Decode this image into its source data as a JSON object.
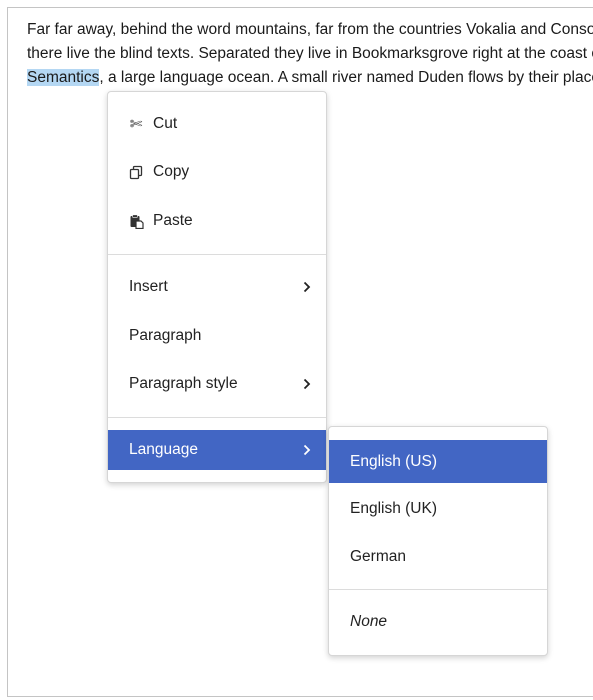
{
  "document": {
    "line1": "Far far away, behind the word mountains, far from the countries Vokalia and Consonantia,",
    "line2": "there live the blind texts. Separated they live in Bookmarksgrove right at the coast of the",
    "line3_selected": "Semantics",
    "line3_rest": ", a large language ocean. A small river named Duden flows by their place."
  },
  "context_menu": {
    "items": [
      {
        "label": "Cut",
        "icon": "scissors-icon"
      },
      {
        "label": "Copy",
        "icon": "copy-icon"
      },
      {
        "label": "Paste",
        "icon": "paste-icon"
      },
      {
        "label": "Insert",
        "submenu": true
      },
      {
        "label": "Paragraph"
      },
      {
        "label": "Paragraph style",
        "submenu": true
      },
      {
        "label": "Language",
        "submenu": true,
        "active": true
      }
    ]
  },
  "language_submenu": {
    "items": [
      {
        "label": "English (US)",
        "active": true
      },
      {
        "label": "English (UK)"
      },
      {
        "label": "German"
      },
      {
        "label": "None",
        "italic": true
      }
    ]
  },
  "colors": {
    "highlight": "#4266c4",
    "selection": "#b4d7f3"
  }
}
